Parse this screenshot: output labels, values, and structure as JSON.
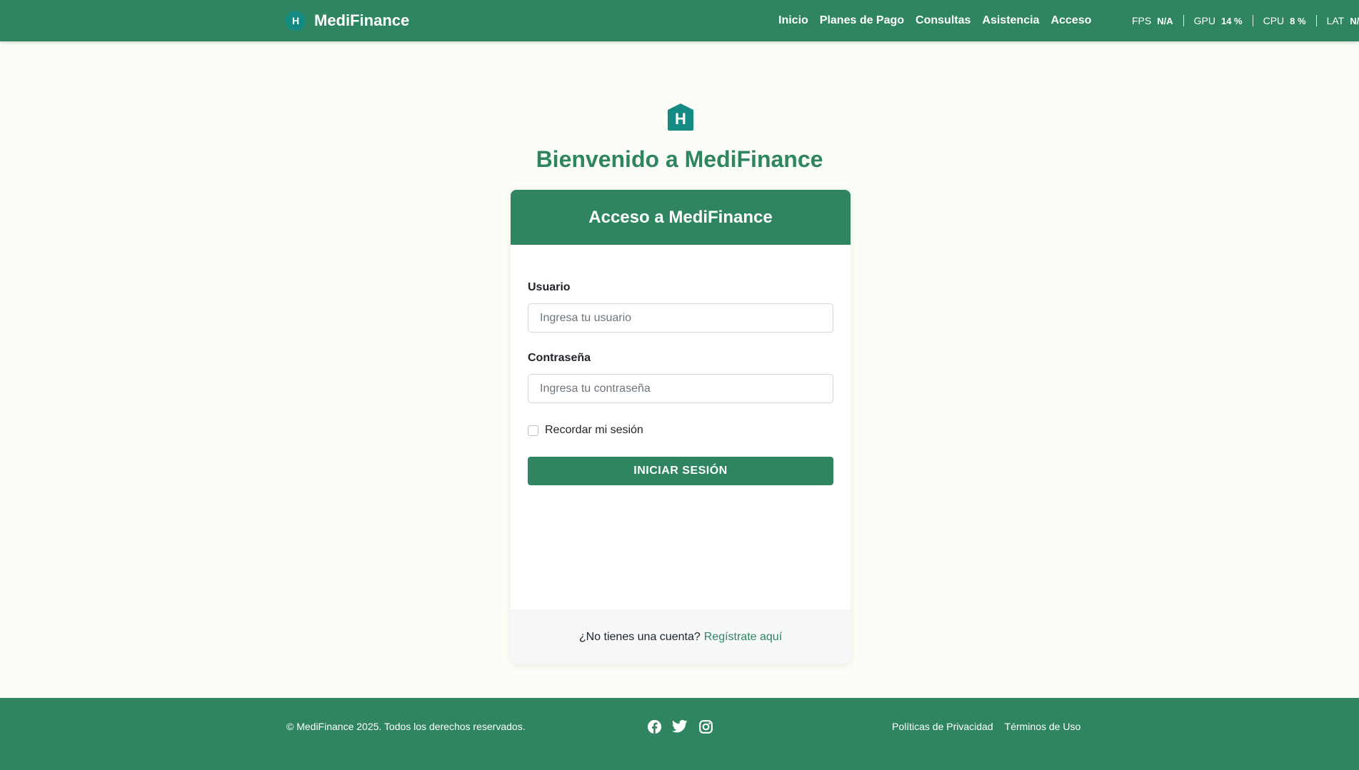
{
  "brand": {
    "logo_letter": "H",
    "name": "MediFinance"
  },
  "nav": {
    "links": [
      "Inicio",
      "Planes de Pago",
      "Consultas",
      "Asistencia",
      "Acceso"
    ]
  },
  "perf": [
    {
      "label": "FPS",
      "value": "N/A"
    },
    {
      "label": "GPU",
      "value": "14 %"
    },
    {
      "label": "CPU",
      "value": "8 %"
    },
    {
      "label": "LAT",
      "value": "N/A"
    }
  ],
  "hero": {
    "icon_letter": "H",
    "title": "Bienvenido a MediFinance"
  },
  "login": {
    "header": "Acceso a MediFinance",
    "username_label": "Usuario",
    "username_placeholder": "Ingresa tu usuario",
    "password_label": "Contraseña",
    "password_placeholder": "Ingresa tu contraseña",
    "remember_label": "Recordar mi sesión",
    "submit_label": "INICIAR SESIÓN",
    "no_account_text": "¿No tienes una cuenta?",
    "register_link": "Regístrate aquí"
  },
  "footer": {
    "copyright": "© MediFinance 2025. Todos los derechos reservados.",
    "social_icons": [
      "facebook-icon",
      "twitter-icon",
      "instagram-icon"
    ],
    "links": [
      "Políticas de Privacidad",
      "Términos de Uso"
    ]
  },
  "colors": {
    "primary": "#2e8560",
    "logo_teal": "#138b83",
    "background": "#fbfef6",
    "card_footer": "#f7f8f9"
  }
}
